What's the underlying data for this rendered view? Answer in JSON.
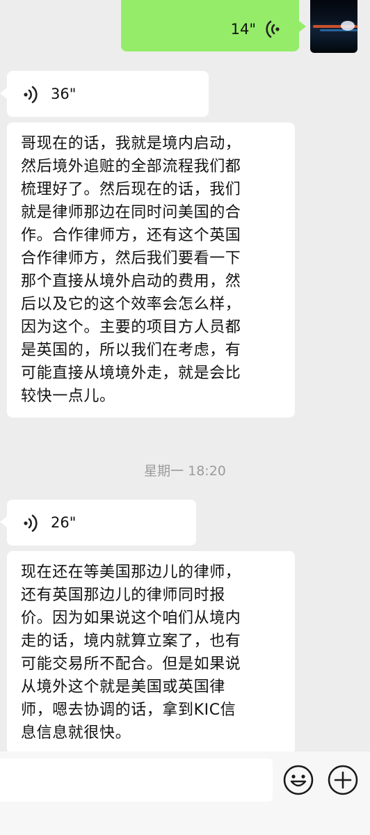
{
  "messages": [
    {
      "type": "voice",
      "direction": "outgoing",
      "duration": "14\""
    },
    {
      "type": "voice",
      "direction": "incoming",
      "duration": "36\""
    },
    {
      "type": "transcript",
      "direction": "incoming",
      "text": "哥现在的话，我就是境内启动，\n然后境外追赃的全部流程我们都\n梳理好了。然后现在的话，我们\n就是律师那边在同时问美国的合\n作。合作律师方，还有这个英国\n合作律师方，然后我们要看一下\n那个直接从境外启动的费用，然\n后以及它的这个效率会怎么样，\n因为这个。主要的项目方人员都\n是英国的，所以我们在考虑，有\n可能直接从境境外走，就是会比\n较快一点儿。"
    },
    {
      "type": "timestamp",
      "text": "星期一 18:20"
    },
    {
      "type": "voice",
      "direction": "incoming",
      "duration": "26\""
    },
    {
      "type": "transcript",
      "direction": "incoming",
      "text": "现在还在等美国那边儿的律师，\n还有英国那边儿的律师同时报\n价。因为如果说这个咱们从境内\n走的话，境内就算立案了，也有\n可能交易所不配合。但是如果说\n从境外这个就是美国或英国律\n师，嗯去协调的话，拿到KIC信\n息信息就很快。"
    }
  ],
  "input_bar": {
    "input_value": "",
    "icons": [
      "emoji-icon",
      "plus-icon"
    ]
  },
  "colors": {
    "background": "#ededed",
    "outgoing_bubble": "#95ec69",
    "incoming_bubble": "#ffffff",
    "timestamp_text": "#9b9b9b"
  }
}
